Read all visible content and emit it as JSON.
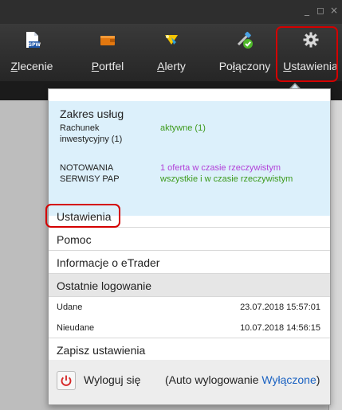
{
  "window": {
    "minimize": "_",
    "restore": "◻",
    "close": "×"
  },
  "toolbar": {
    "items": [
      {
        "label_first": "Z",
        "label_rest": "lecenie",
        "icon": "order-document-icon"
      },
      {
        "label_first": "P",
        "label_rest": "ortfel",
        "icon": "wallet-icon"
      },
      {
        "label_first": "A",
        "label_rest": "lerty",
        "icon": "alert-icon"
      },
      {
        "label_pre": "Po",
        "label_first": "ł",
        "label_rest": "ączony",
        "icon": "connection-icon"
      },
      {
        "label_first": "U",
        "label_rest": "stawienia",
        "icon": "gear-icon"
      }
    ]
  },
  "services": {
    "title": "Zakres usług",
    "account_label_1": "Rachunek",
    "account_label_2": "inwestycyjny (1)",
    "account_value": "aktywne (1)",
    "quotes_label": "NOTOWANIA",
    "quotes_value": "1 oferta w czasie rzeczywistym",
    "pap_label": "SERWISY PAP",
    "pap_value": "wszystkie i w czasie rzeczywistym"
  },
  "menu": {
    "settings": "Ustawienia",
    "help": "Pomoc",
    "about": "Informacje o eTrader",
    "last_login": "Ostatnie logowanie",
    "success_label": "Udane",
    "success_date": "23.07.2018 15:57:01",
    "failed_label": "Nieudane",
    "failed_date": "10.07.2018 14:56:15",
    "save_settings": "Zapisz ustawienia"
  },
  "logout": {
    "label": "Wyloguj się",
    "auto_prefix": "(Auto wylogowanie ",
    "auto_value": "Wyłączone",
    "auto_suffix": ")"
  },
  "colors": {
    "accent_green": "#3d9a1c",
    "accent_purple": "#b13fd8",
    "highlight_red": "#d40000",
    "link_blue": "#1a62c2"
  }
}
